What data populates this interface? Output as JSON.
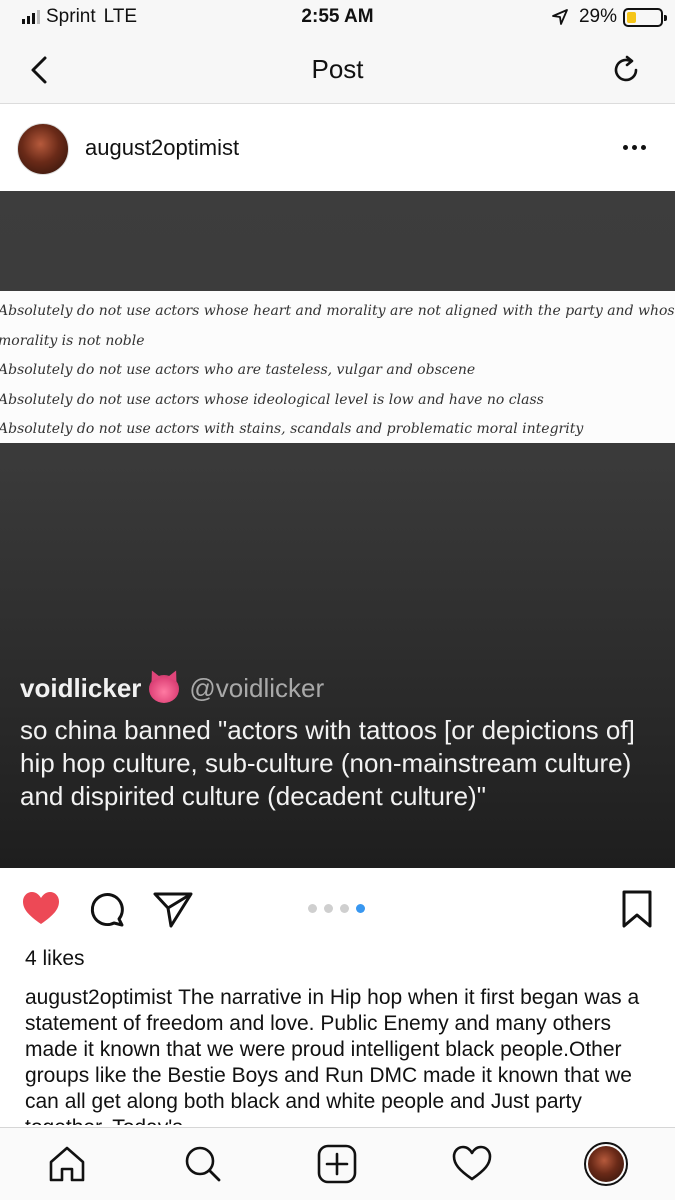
{
  "status_bar": {
    "carrier": "Sprint",
    "network": "LTE",
    "time": "2:55 AM",
    "battery_percent": "29%",
    "battery_level": 0.29,
    "battery_color": "#f5c518"
  },
  "nav": {
    "title": "Post",
    "back_icon": "chevron-left-icon",
    "refresh_icon": "refresh-icon"
  },
  "post": {
    "username": "august2optimist",
    "more_icon": "more-horizontal-icon",
    "image": {
      "quote_lines": [
        "Absolutely do not use actors whose heart and morality are not aligned with the party and whose",
        "morality is not noble",
        "Absolutely do not use actors who are tasteless, vulgar and obscene",
        "Absolutely do not use actors whose ideological level is low and have no class",
        "Absolutely do not use actors with stains, scandals and problematic moral integrity"
      ],
      "tweet": {
        "name": "voidlicker",
        "handle": "@voidlicker",
        "text": "so china banned \"actors with tattoos [or depictions of] hip hop culture, sub-culture (non-mainstream culture) and dispirited culture (decadent culture)\""
      }
    },
    "carousel": {
      "total": 4,
      "active_index": 3,
      "active_color": "#3897f0"
    },
    "likes": "4 likes",
    "caption_user": "august2optimist",
    "caption_text": "The narrative in Hip hop when it first began was a statement of freedom and love. Public Enemy and many others made it known that we were proud intelligent black people.Other groups like the Bestie Boys and Run DMC made it known that we can all get along both black and white people and Just party together. Today's",
    "like_color": "#ed4956"
  },
  "tabbar": {
    "items": [
      "home-icon",
      "search-icon",
      "add-post-icon",
      "activity-heart-icon",
      "profile-avatar"
    ]
  }
}
